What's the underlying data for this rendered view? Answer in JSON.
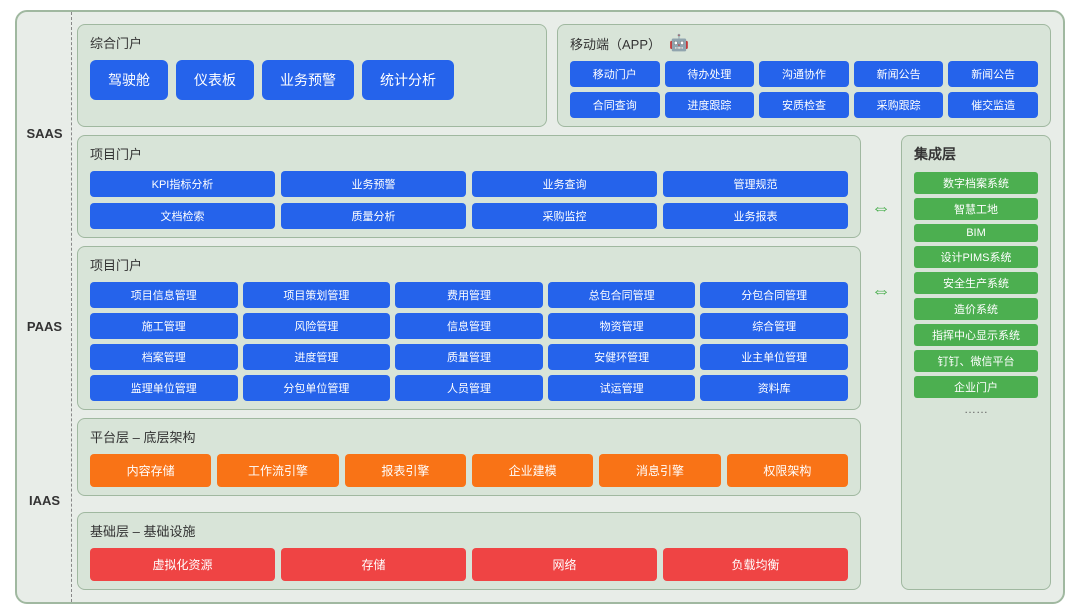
{
  "side_labels": {
    "saas": "SAAS",
    "paas": "PAAS",
    "iaas": "IAAS"
  },
  "zonghe": {
    "title": "综合门户",
    "buttons": [
      "驾驶舱",
      "仪表板",
      "业务预警",
      "统计分析"
    ]
  },
  "mobile": {
    "title": "移动端（APP）",
    "android_icon": "🤖",
    "apple_icon": "",
    "buttons": [
      "移动门户",
      "待办处理",
      "沟通协作",
      "新闻公告",
      "新闻公告",
      "合同查询",
      "进度跟踪",
      "安质检查",
      "采购跟踪",
      "催交监造"
    ]
  },
  "integration": {
    "title": "集成层",
    "items": [
      "数字档案系统",
      "智慧工地",
      "BIM",
      "设计PIMS系统",
      "安全生产系统",
      "造价系统",
      "指挥中心显示系统",
      "钉钉、微信平台",
      "企业门户",
      "……"
    ]
  },
  "project_portal": {
    "title": "项目门户",
    "buttons": [
      "KPI指标分析",
      "业务预警",
      "业务查询",
      "管理规范",
      "文档检索",
      "质量分析",
      "采购监控",
      "业务报表"
    ]
  },
  "project_mgmt": {
    "title": "项目门户",
    "buttons": [
      "项目信息管理",
      "项目策划管理",
      "费用管理",
      "总包合同管理",
      "分包合同管理",
      "施工管理",
      "风险管理",
      "信息管理",
      "物资管理",
      "综合管理",
      "档案管理",
      "进度管理",
      "质量管理",
      "安健环管理",
      "业主单位管理",
      "监理单位管理",
      "分包单位管理",
      "人员管理",
      "试运管理",
      "资料库"
    ]
  },
  "platform": {
    "title": "平台层 – 底层架构",
    "buttons": [
      "内容存储",
      "工作流引擎",
      "报表引擎",
      "企业建模",
      "消息引擎",
      "权限架构"
    ]
  },
  "infra": {
    "title": "基础层 – 基础设施",
    "buttons": [
      "虚拟化资源",
      "存储",
      "网络",
      "负载均衡"
    ]
  }
}
